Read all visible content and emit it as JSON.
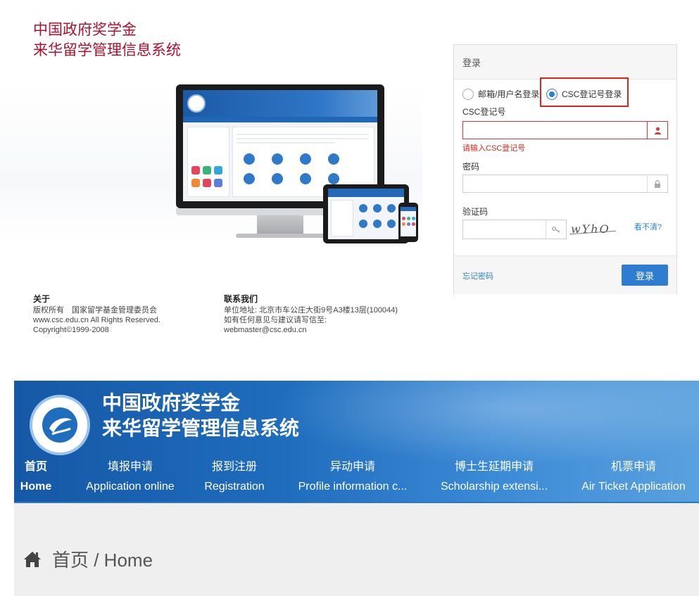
{
  "site": {
    "title_line1": "中国政府奖学金",
    "title_line2": "来华留学管理信息系统"
  },
  "footer": {
    "about_heading": "关于",
    "about_lines": [
      "版权所有　国家留学基金管理委员会",
      "www.csc.edu.cn All Rights Reserved.",
      "Copyright©1999-2008"
    ],
    "contact_heading": "联系我们",
    "contact_lines": [
      "单位地址: 北京市车公庄大街9号A3楼13层(100044)",
      "如有任何意见与建议请写信至:",
      "webmaster@csc.edu.cn"
    ]
  },
  "login": {
    "title": "登录",
    "radio_email": "邮箱/用户名登录",
    "radio_csc": "CSC登记号登录",
    "csc_label": "CSC登记号",
    "csc_value": "",
    "csc_error": "请输入CSC登记号",
    "password_label": "密码",
    "password_value": "",
    "captcha_label": "验证码",
    "captcha_value": "",
    "captcha_text": "wYhO",
    "refresh_captcha": "看不清?",
    "forgot_password": "忘记密码",
    "submit": "登录",
    "colors": {
      "primary": "#2e7dd1",
      "error": "#e0231d",
      "brand": "#b0102d"
    }
  },
  "banner": {
    "title_line1": "中国政府奖学金",
    "title_line2": "来华留学管理信息系统",
    "nav": [
      {
        "zh": "首页",
        "en": "Home",
        "active": true
      },
      {
        "zh": "填报申请",
        "en": "Application online"
      },
      {
        "zh": "报到注册",
        "en": "Registration"
      },
      {
        "zh": "异动申请",
        "en": "Profile information c..."
      },
      {
        "zh": "博士生延期申请",
        "en": "Scholarship extensi..."
      },
      {
        "zh": "机票申请",
        "en": "Air Ticket Application"
      }
    ]
  },
  "page": {
    "heading": "首页 / Home",
    "heading_icon": "home-icon"
  }
}
